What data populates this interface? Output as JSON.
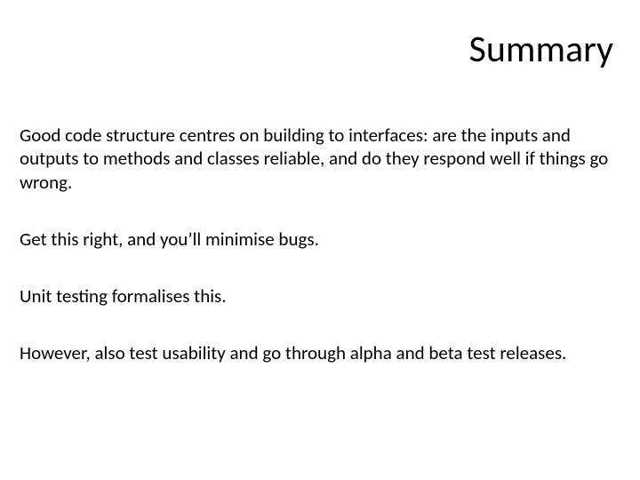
{
  "slide": {
    "title": "Summary",
    "paragraphs": [
      "Good code structure centres on building to interfaces: are the inputs and outputs to methods and classes reliable, and do they respond well if things go wrong.",
      "Get this right, and you’ll minimise bugs.",
      "Unit testing formalises this.",
      "However, also test usability and go through alpha and beta test releases."
    ]
  }
}
